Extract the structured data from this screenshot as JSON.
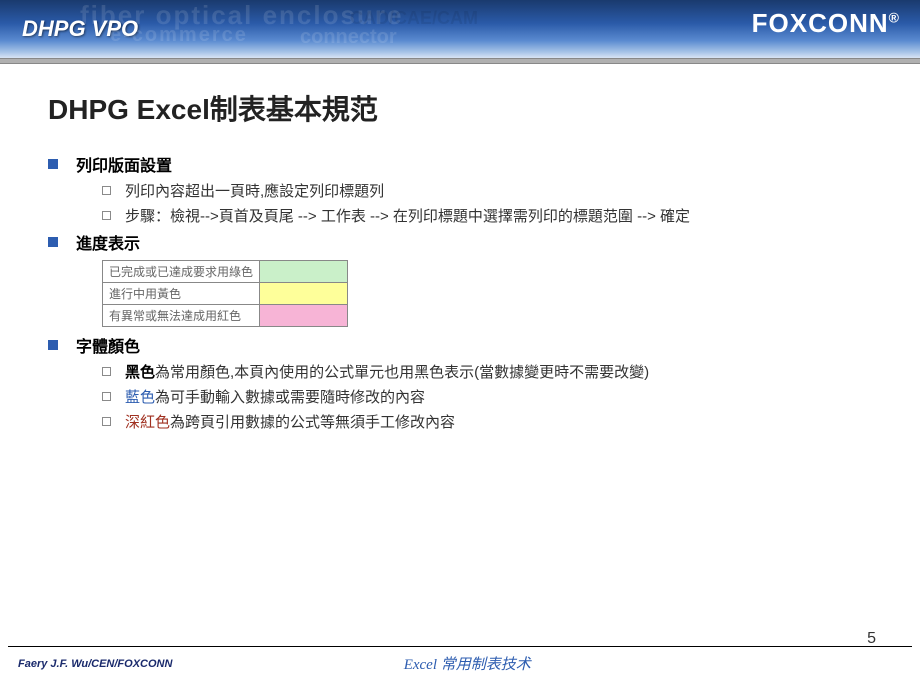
{
  "header": {
    "title": "DHPG VPO",
    "logo": "FOXCONN",
    "bg1": "fiber optical enclosure",
    "bg2": "connector",
    "bg3": "CAD/CAE/CAM",
    "bg4": "e-commerce"
  },
  "slide": {
    "title": "DHPG Excel制表基本規范",
    "pageNumber": "5"
  },
  "sections": {
    "print": {
      "heading": "列印版面設置",
      "sub1": "列印內容超出一頁時,應設定列印標題列",
      "sub2": "步驟：檢視-->頁首及頁尾 --> 工作表 --> 在列印標題中選擇需列印的標題范圍 --> 確定"
    },
    "progress": {
      "heading": "進度表示",
      "rows": {
        "r1": "已完成或已達成要求用綠色",
        "r2": "進行中用黃色",
        "r3": "有異常或無法達成用紅色"
      }
    },
    "font": {
      "heading": "字體顏色",
      "black_label": "黑色",
      "black_rest": "為常用顏色,本頁內使用的公式單元也用黑色表示(當數據變更時不需要改變)",
      "blue_label": "藍色",
      "blue_rest": "為可手動輸入數據或需要隨時修改的內容",
      "red_label": "深紅色",
      "red_rest": "為跨頁引用數據的公式等無須手工修改內容"
    }
  },
  "footer": {
    "left": "Faery J.F. Wu/CEN/FOXCONN",
    "center": "Excel 常用制表技术"
  }
}
